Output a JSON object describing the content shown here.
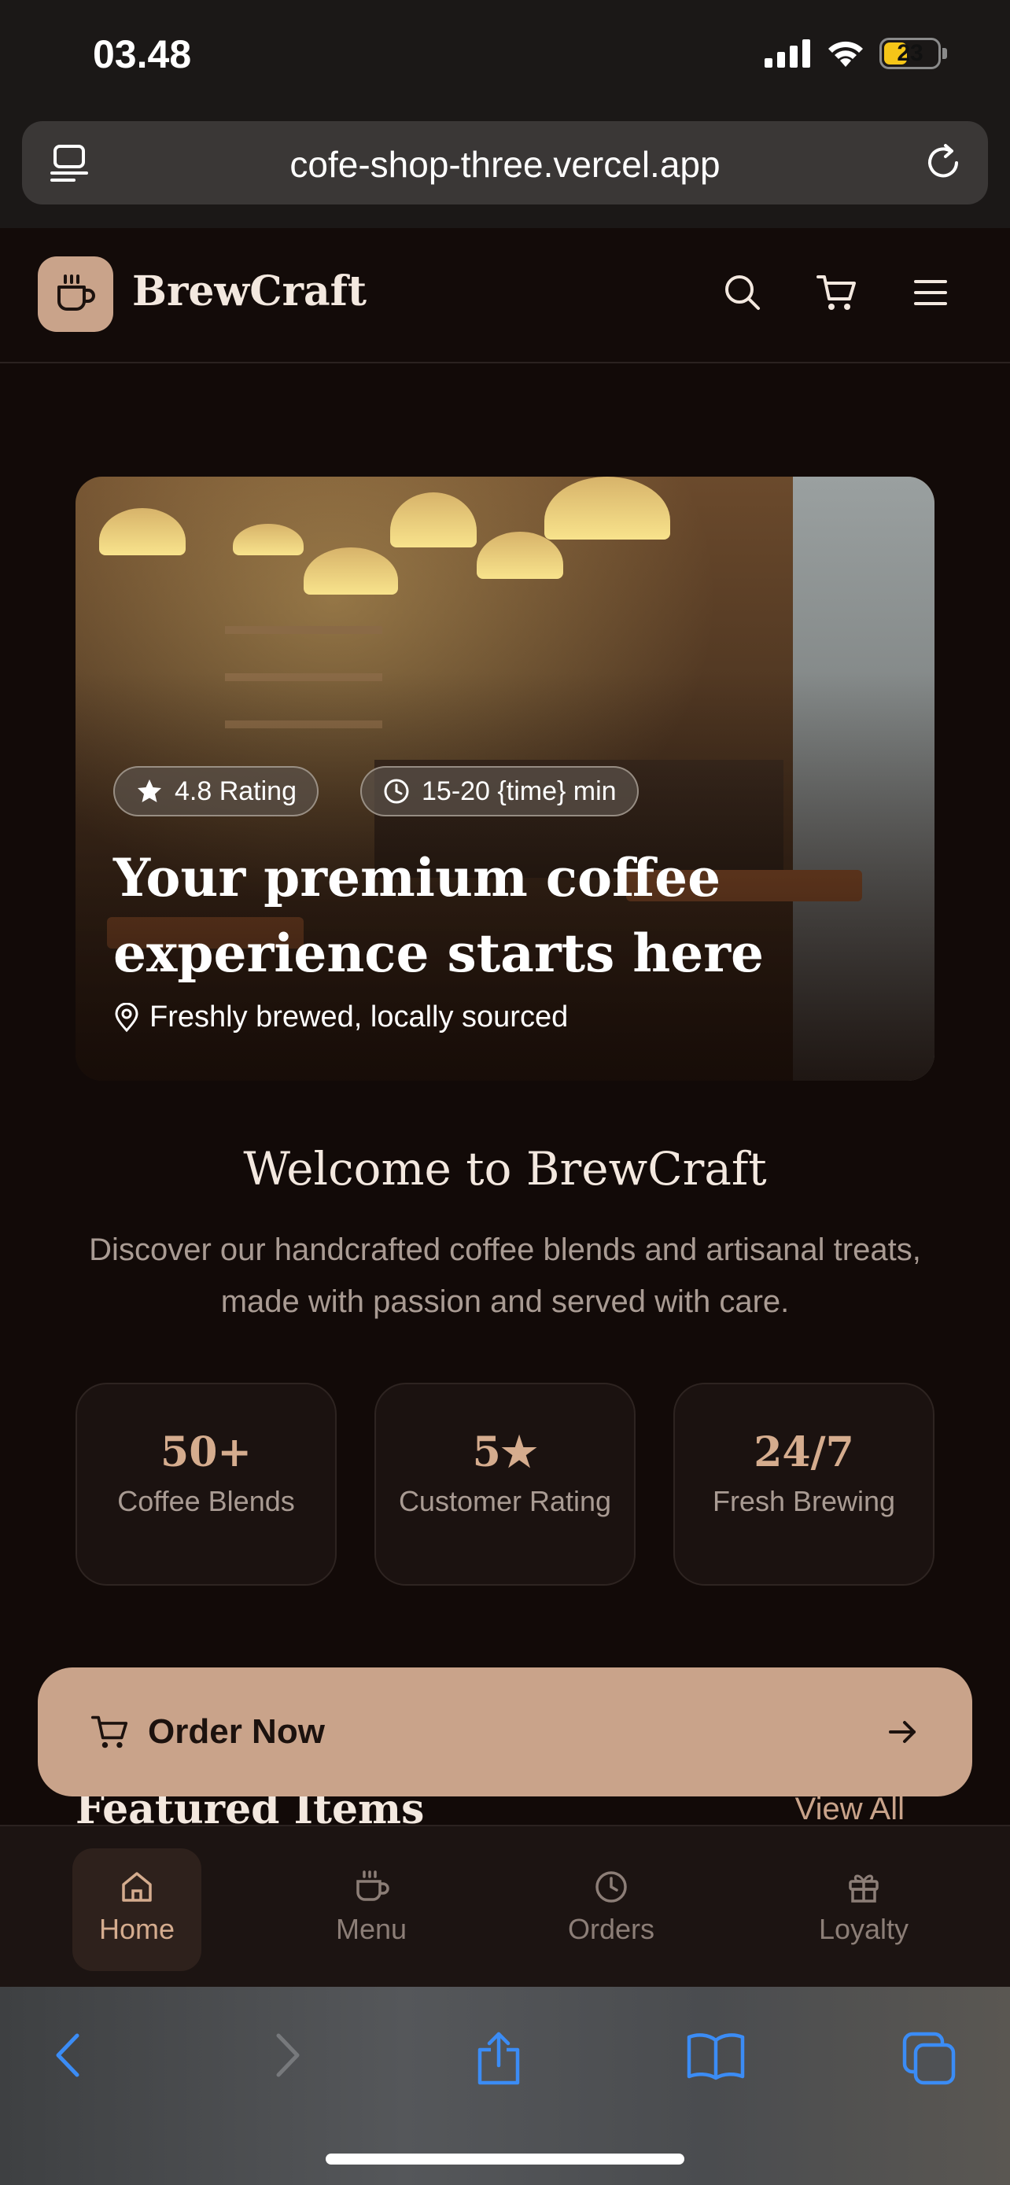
{
  "status_bar": {
    "time": "03.48",
    "battery": "23"
  },
  "browser": {
    "url": "cofe-shop-three.vercel.app"
  },
  "header": {
    "brand": "BrewCraft"
  },
  "hero": {
    "rating_badge": "4.8 Rating",
    "time_badge": "15-20 {time} min",
    "title_line1": "Your premium coffee",
    "title_line2": "experience starts here",
    "subtitle": "Freshly brewed, locally sourced"
  },
  "welcome": {
    "title": "Welcome to BrewCraft",
    "description": "Discover our handcrafted coffee blends and artisanal treats, made with passion and served with care."
  },
  "stats": [
    {
      "value": "50+",
      "label": "Coffee Blends"
    },
    {
      "value": "5★",
      "label": "Customer Rating"
    },
    {
      "value": "24/7",
      "label": "Fresh Brewing"
    }
  ],
  "featured": {
    "title": "Featured Items",
    "view_all": "View All"
  },
  "order_button": {
    "label": "Order Now"
  },
  "bottom_nav": [
    {
      "label": "Home",
      "icon": "home-icon",
      "active": true
    },
    {
      "label": "Menu",
      "icon": "cup-icon",
      "active": false
    },
    {
      "label": "Orders",
      "icon": "clock-icon",
      "active": false
    },
    {
      "label": "Loyalty",
      "icon": "gift-icon",
      "active": false
    }
  ],
  "colors": {
    "accent": "#c9a38a",
    "background": "#120a08",
    "ios_blue": "#3b8cf5"
  }
}
